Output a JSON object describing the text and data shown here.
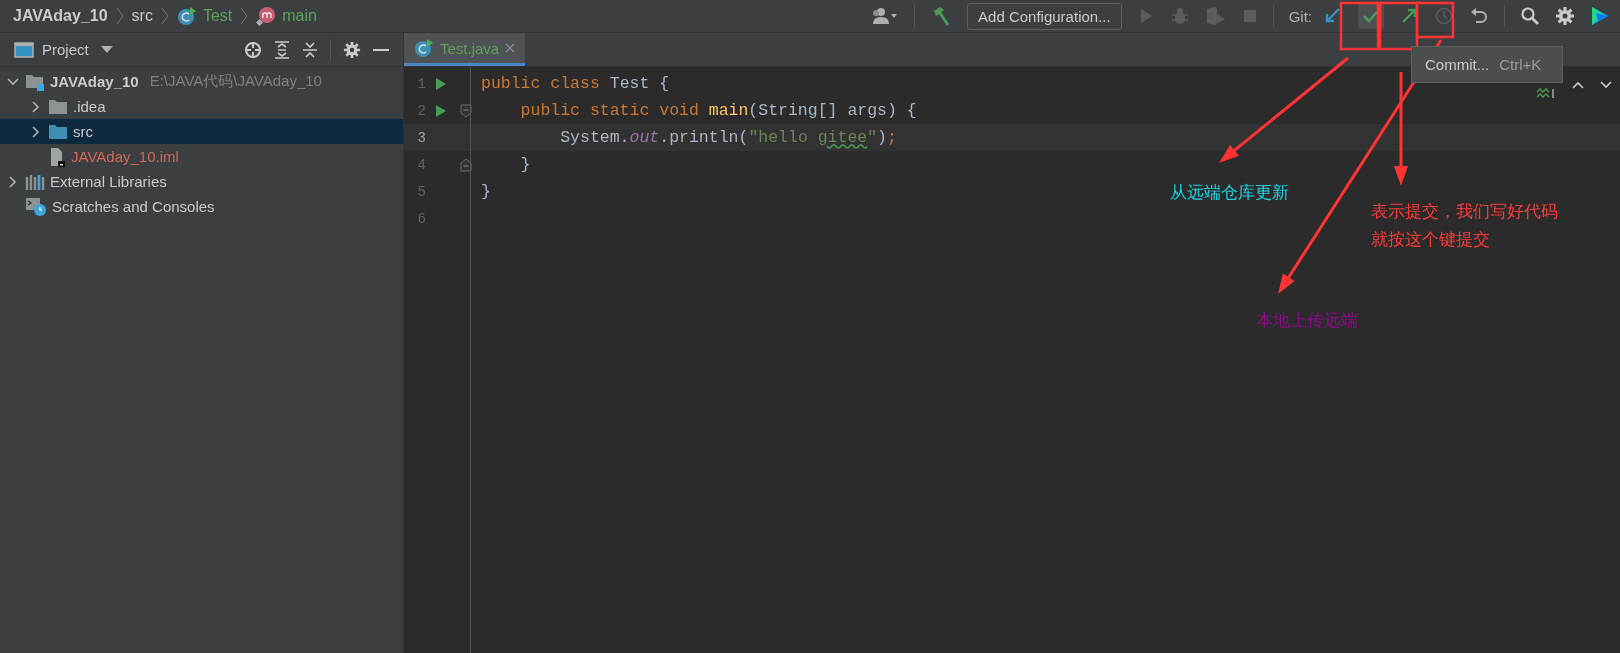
{
  "breadcrumbs": [
    {
      "label": "JAVAday_10",
      "kind": "project"
    },
    {
      "label": "src",
      "kind": "folder"
    },
    {
      "label": "Test",
      "kind": "class"
    },
    {
      "label": "main",
      "kind": "method"
    }
  ],
  "toolbar": {
    "config_button": "Add Configuration...",
    "git_label": "Git:"
  },
  "project_panel": {
    "title": "Project",
    "tree": [
      {
        "label": "JAVAday_10",
        "kind": "project",
        "path": "E:\\JAVA代码\\JAVAday_10",
        "expanded": true,
        "selected": false,
        "children": [
          {
            "label": ".idea",
            "kind": "folder",
            "expanded": false,
            "selected": false
          },
          {
            "label": "src",
            "kind": "sources",
            "expanded": false,
            "selected": true
          },
          {
            "label": "JAVAday_10.iml",
            "kind": "file",
            "unversioned": true,
            "selected": false
          }
        ]
      },
      {
        "label": "External Libraries",
        "kind": "libraries",
        "expanded": false,
        "selected": false
      },
      {
        "label": "Scratches and Consoles",
        "kind": "scratches",
        "selected": false
      }
    ]
  },
  "tabs": [
    {
      "label": "Test.java",
      "selected": true
    }
  ],
  "editor": {
    "lines": [
      {
        "number": "1",
        "run": true,
        "current": false,
        "tokens": [
          {
            "text": "public class ",
            "kind": "keyword"
          },
          {
            "text": "Test {",
            "kind": "plain"
          }
        ]
      },
      {
        "number": "2",
        "run": true,
        "current": false,
        "fold_start": true,
        "tokens": [
          {
            "text": "    public static void ",
            "kind": "keyword"
          },
          {
            "text": "main",
            "kind": "declaration"
          },
          {
            "text": "(String[] args) {",
            "kind": "plain"
          }
        ]
      },
      {
        "number": "3",
        "run": false,
        "current": true,
        "tokens": [
          {
            "text": "        System.",
            "kind": "plain"
          },
          {
            "text": "out",
            "kind": "field"
          },
          {
            "text": ".println(",
            "kind": "plain"
          },
          {
            "text": "\"hello ",
            "kind": "string"
          },
          {
            "text": "gitee",
            "kind": "string",
            "typo": true
          },
          {
            "text": "\"",
            "kind": "string"
          },
          {
            "text": ")",
            "kind": "plain"
          },
          {
            "text": ";",
            "kind": "separator"
          }
        ]
      },
      {
        "number": "4",
        "run": false,
        "current": false,
        "fold_end": true,
        "tokens": [
          {
            "text": "    }",
            "kind": "plain"
          }
        ]
      },
      {
        "number": "5",
        "run": false,
        "current": false,
        "tokens": [
          {
            "text": "}",
            "kind": "plain"
          }
        ]
      },
      {
        "number": "6",
        "run": false,
        "current": false
      }
    ]
  },
  "tooltip": {
    "label": "Commit...",
    "shortcut": "Ctrl+K"
  },
  "annotations": [
    {
      "lines": [
        "从远端仓库更新"
      ],
      "color": "#22d3dd"
    },
    {
      "lines": [
        "表示提交，我们写好代码",
        "就按这个键提交"
      ],
      "color": "#ff3a3a"
    },
    {
      "lines": [
        "本地上传远端"
      ],
      "color": "#8e0a8e"
    }
  ]
}
